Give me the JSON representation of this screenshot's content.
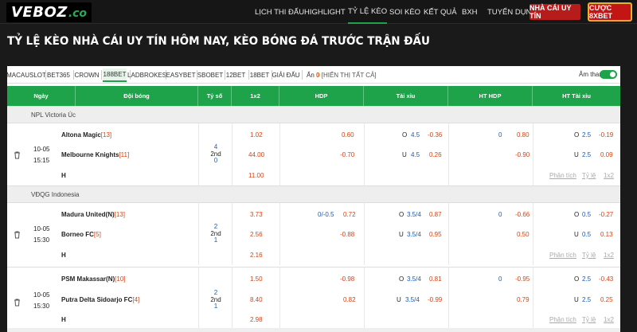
{
  "header": {
    "logo_main": "VEBOZ",
    "logo_suffix": ".co",
    "nav": [
      {
        "label": "LỊCH THI ĐẤU",
        "active": false
      },
      {
        "label": "HIGHLIGHT",
        "active": false
      },
      {
        "label": "TỶ LỆ KÈO",
        "active": true
      },
      {
        "label": "SOI KÈO",
        "active": false
      },
      {
        "label": "KẾT QUẢ",
        "active": false
      },
      {
        "label": "BXH",
        "active": false
      },
      {
        "label": "TUYỂN DỤNG",
        "active": false
      }
    ],
    "btn_nhacai": "NHÀ CÁI UY TÍN",
    "btn_cuoc": "CƯỢC 8XBET"
  },
  "page_title": "TỶ LỆ KÈO NHÀ CÁI UY TÍN HÔM NAY, KÈO BÓNG ĐÁ TRƯỚC TRẬN ĐẤU",
  "tabs": [
    "MACAUSLOT",
    "BET365",
    "CROWN",
    "188BET",
    "LADBROKES",
    "EASYBET",
    "SBOBET",
    "12BET",
    "18BET",
    "GIẢI ĐẤU"
  ],
  "active_tab": "188BET",
  "hidden": {
    "prefix": "Ẩn",
    "count": "0",
    "link": "[HIỂN THỊ TẤT CẢ]"
  },
  "sound_label": "Âm thanh",
  "columns": [
    "Ngày",
    "Đội bóng",
    "Tỷ số",
    "1x2",
    "HDP",
    "Tài xỉu",
    "HT HDP",
    "HT Tài xỉu"
  ],
  "colors": {
    "accent": "#1fa34a",
    "red": "#d84315",
    "blue": "#1e5ab5"
  },
  "links": {
    "analysis": "Phân tích",
    "odds": "Tỷ lệ",
    "x12": "1x2"
  },
  "leagues": [
    {
      "name": "NPL Victoria Úc",
      "match": {
        "date": "10-05",
        "time": "15:15",
        "home": "Altona Magic",
        "home_rank": "[13]",
        "away": "Melbourne Knights",
        "away_rank": "[11]",
        "draw_label": "H",
        "score_top": "4",
        "score_mid": "2nd",
        "score_bot": "0",
        "x12": [
          "1.02",
          "44.00",
          "11.00"
        ],
        "hdp_line": "",
        "hdp": [
          "0.60",
          "-0.70"
        ],
        "ou_home": {
          "side": "O",
          "line": "4.5",
          "odd": "-0.36"
        },
        "ou_away": {
          "side": "U",
          "line": "4.5",
          "odd": "0.26"
        },
        "hthdp_line": "0",
        "hthdp": [
          "0.80",
          "-0.90"
        ],
        "htou_home": {
          "side": "O",
          "line": "2.5",
          "odd": "-0.19"
        },
        "htou_away": {
          "side": "U",
          "line": "2.5",
          "odd": "0.09"
        }
      }
    },
    {
      "name": "VĐQG Indonesia",
      "match": {
        "date": "10-05",
        "time": "15:30",
        "home": "Madura United(N)",
        "home_rank": "[13]",
        "away": "Borneo FC",
        "away_rank": "[5]",
        "draw_label": "H",
        "score_top": "2",
        "score_mid": "2nd",
        "score_bot": "1",
        "x12": [
          "3.73",
          "2.56",
          "2.16"
        ],
        "hdp_line": "0/-0.5",
        "hdp": [
          "0.72",
          "-0.88"
        ],
        "ou_home": {
          "side": "O",
          "line": "3.5/4",
          "odd": "0.87"
        },
        "ou_away": {
          "side": "U",
          "line": "3.5/4",
          "odd": "0.95"
        },
        "hthdp_line": "0",
        "hthdp": [
          "-0.66",
          "0.50"
        ],
        "htou_home": {
          "side": "O",
          "line": "0.5",
          "odd": "-0.27"
        },
        "htou_away": {
          "side": "U",
          "line": "0.5",
          "odd": "0.13"
        }
      }
    },
    {
      "name": "",
      "match": {
        "date": "10-05",
        "time": "15:30",
        "home": "PSM Makassar(N)",
        "home_rank": "[10]",
        "away": "Putra Delta Sidoarjo FC",
        "away_rank": "[4]",
        "draw_label": "H",
        "score_top": "2",
        "score_mid": "2nd",
        "score_bot": "1",
        "x12": [
          "1.50",
          "8.40",
          "2.98"
        ],
        "hdp_line": "",
        "hdp": [
          "-0.98",
          "0.82"
        ],
        "ou_home": {
          "side": "O",
          "line": "3.5/4",
          "odd": "0.81"
        },
        "ou_away": {
          "side": "U",
          "line": "3.5/4",
          "odd": "-0.99"
        },
        "hthdp_line": "0",
        "hthdp": [
          "-0.95",
          "0.79"
        ],
        "htou_home": {
          "side": "O",
          "line": "2.5",
          "odd": "-0.43"
        },
        "htou_away": {
          "side": "U",
          "line": "2.5",
          "odd": "0.25"
        }
      }
    }
  ]
}
